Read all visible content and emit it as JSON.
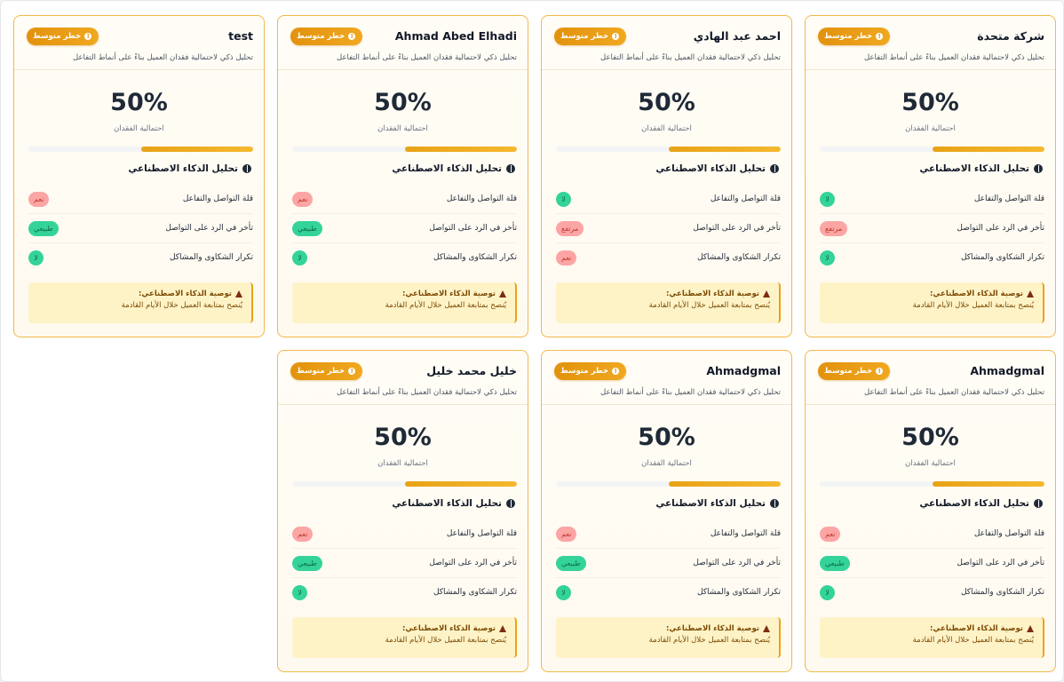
{
  "common": {
    "risk_badge": "خطر متوسط",
    "subtitle": "تحليل ذكي لاحتمالية فقدان العميل بناءً على أنماط التفاعل",
    "probability_label": "احتمالية الفقدان",
    "ai_heading": "تحليل الذكاء الاصطناعي",
    "factor_labels": [
      "قلة التواصل والتفاعل",
      "تأخر في الرد على التواصل",
      "تكرار الشكاوى والمشاكل"
    ],
    "recommendation_title": "توصية الذكاء الاصطناعي:",
    "recommendation_text": "يُنصح بمتابعة العميل خلال الأيام القادمة"
  },
  "colors": {
    "accent": "#e8a317",
    "card_border": "#f1b84a",
    "pill_red": "#fca5a5",
    "pill_green": "#34d399"
  },
  "cards": [
    {
      "name": "شركة متحدة",
      "percent": "50%",
      "risk_fraction": 0.5,
      "factors": [
        {
          "value": "لا",
          "tone": "green"
        },
        {
          "value": "مرتفع",
          "tone": "red"
        },
        {
          "value": "لا",
          "tone": "green"
        }
      ]
    },
    {
      "name": "احمد عبد الهادي",
      "percent": "50%",
      "risk_fraction": 0.5,
      "factors": [
        {
          "value": "لا",
          "tone": "green"
        },
        {
          "value": "مرتفع",
          "tone": "red"
        },
        {
          "value": "نعم",
          "tone": "red"
        }
      ]
    },
    {
      "name": "Ahmad Abed Elhadi",
      "percent": "50%",
      "risk_fraction": 0.5,
      "factors": [
        {
          "value": "نعم",
          "tone": "red"
        },
        {
          "value": "طبيعي",
          "tone": "green"
        },
        {
          "value": "لا",
          "tone": "green"
        }
      ]
    },
    {
      "name": "test",
      "percent": "50%",
      "risk_fraction": 0.5,
      "factors": [
        {
          "value": "نعم",
          "tone": "red"
        },
        {
          "value": "طبيعي",
          "tone": "green"
        },
        {
          "value": "لا",
          "tone": "green"
        }
      ]
    },
    {
      "name": "Ahmadgmal",
      "percent": "50%",
      "risk_fraction": 0.5,
      "factors": [
        {
          "value": "نعم",
          "tone": "red"
        },
        {
          "value": "طبيعي",
          "tone": "green"
        },
        {
          "value": "لا",
          "tone": "green"
        }
      ]
    },
    {
      "name": "Ahmadgmal",
      "percent": "50%",
      "risk_fraction": 0.5,
      "factors": [
        {
          "value": "نعم",
          "tone": "red"
        },
        {
          "value": "طبيعي",
          "tone": "green"
        },
        {
          "value": "لا",
          "tone": "green"
        }
      ]
    },
    {
      "name": "خليل محمد خليل",
      "percent": "50%",
      "risk_fraction": 0.5,
      "factors": [
        {
          "value": "نعم",
          "tone": "red"
        },
        {
          "value": "طبيعي",
          "tone": "green"
        },
        {
          "value": "لا",
          "tone": "green"
        }
      ]
    }
  ]
}
